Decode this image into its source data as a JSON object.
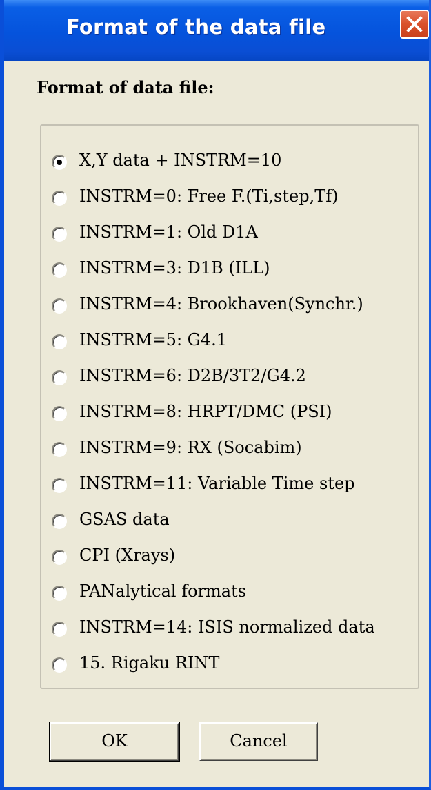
{
  "window": {
    "title": "Format of the data file"
  },
  "dialog": {
    "heading": "Format of data file:"
  },
  "options": [
    {
      "label": "X,Y data + INSTRM=10",
      "selected": true
    },
    {
      "label": "INSTRM=0: Free F.(Ti,step,Tf)",
      "selected": false
    },
    {
      "label": "INSTRM=1: Old D1A",
      "selected": false
    },
    {
      "label": "INSTRM=3: D1B (ILL)",
      "selected": false
    },
    {
      "label": "INSTRM=4: Brookhaven(Synchr.)",
      "selected": false
    },
    {
      "label": "INSTRM=5: G4.1",
      "selected": false
    },
    {
      "label": "INSTRM=6: D2B/3T2/G4.2",
      "selected": false
    },
    {
      "label": "INSTRM=8: HRPT/DMC (PSI)",
      "selected": false
    },
    {
      "label": "INSTRM=9: RX (Socabim)",
      "selected": false
    },
    {
      "label": "INSTRM=11: Variable Time step",
      "selected": false
    },
    {
      "label": "GSAS data",
      "selected": false
    },
    {
      "label": "CPI (Xrays)",
      "selected": false
    },
    {
      "label": "PANalytical formats",
      "selected": false
    },
    {
      "label": "INSTRM=14: ISIS normalized data",
      "selected": false
    },
    {
      "label": "15. Rigaku RINT",
      "selected": false
    }
  ],
  "buttons": {
    "ok_label": "OK",
    "cancel_label": "Cancel"
  },
  "icons": {
    "close": "close-icon",
    "radio": "radio-button-icon"
  },
  "colors": {
    "titlebar": "#0553dc",
    "dialog_background": "#ece9d8",
    "close_button": "#d9502a"
  }
}
